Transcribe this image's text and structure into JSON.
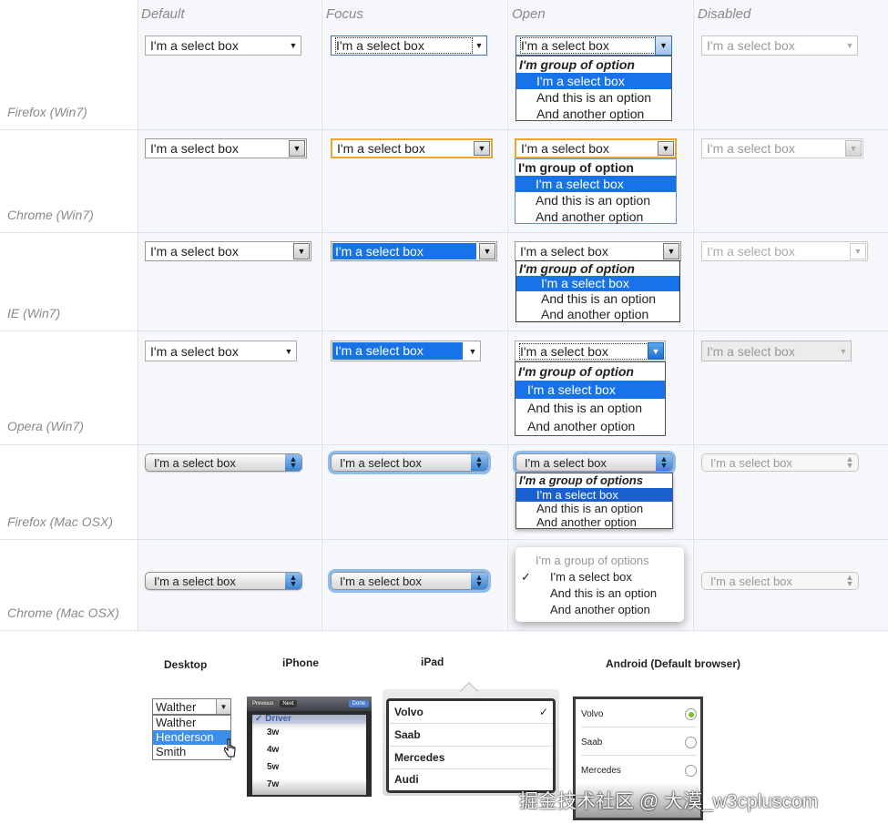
{
  "columns": [
    "Default",
    "Focus",
    "Open",
    "Disabled"
  ],
  "rows": [
    "Firefox (Win7)",
    "Chrome (Win7)",
    "IE (Win7)",
    "Opera (Win7)",
    "Firefox (Mac OSX)",
    "Chrome (Mac OSX)"
  ],
  "select_text": "I'm a select box",
  "group_label": "I'm group of option",
  "group_label_mac": "I'm a group of options",
  "option_2": "And this is an option",
  "option_3": "And another option",
  "bottom": {
    "desktop": {
      "title": "Desktop",
      "value": "Walther",
      "options": [
        "Walther",
        "Henderson",
        "Smith"
      ]
    },
    "iphone": {
      "title": "iPhone",
      "prev": "Previous",
      "next": "Next",
      "done": "Done",
      "items": [
        "Driver",
        "3w",
        "4w",
        "5w",
        "7w"
      ]
    },
    "ipad": {
      "title": "iPad",
      "items": [
        "Volvo",
        "Saab",
        "Mercedes",
        "Audi"
      ],
      "check": "✓"
    },
    "android": {
      "title": "Android (Default browser)",
      "items": [
        "Volvo",
        "Saab",
        "Mercedes"
      ]
    }
  },
  "watermark": "掘金技术社区 @ 大漠_w3cpluscom",
  "colors": {
    "highlight": "#1873e8",
    "focus_orange": "#e8a530",
    "mac_blue": "#3a83d6"
  }
}
